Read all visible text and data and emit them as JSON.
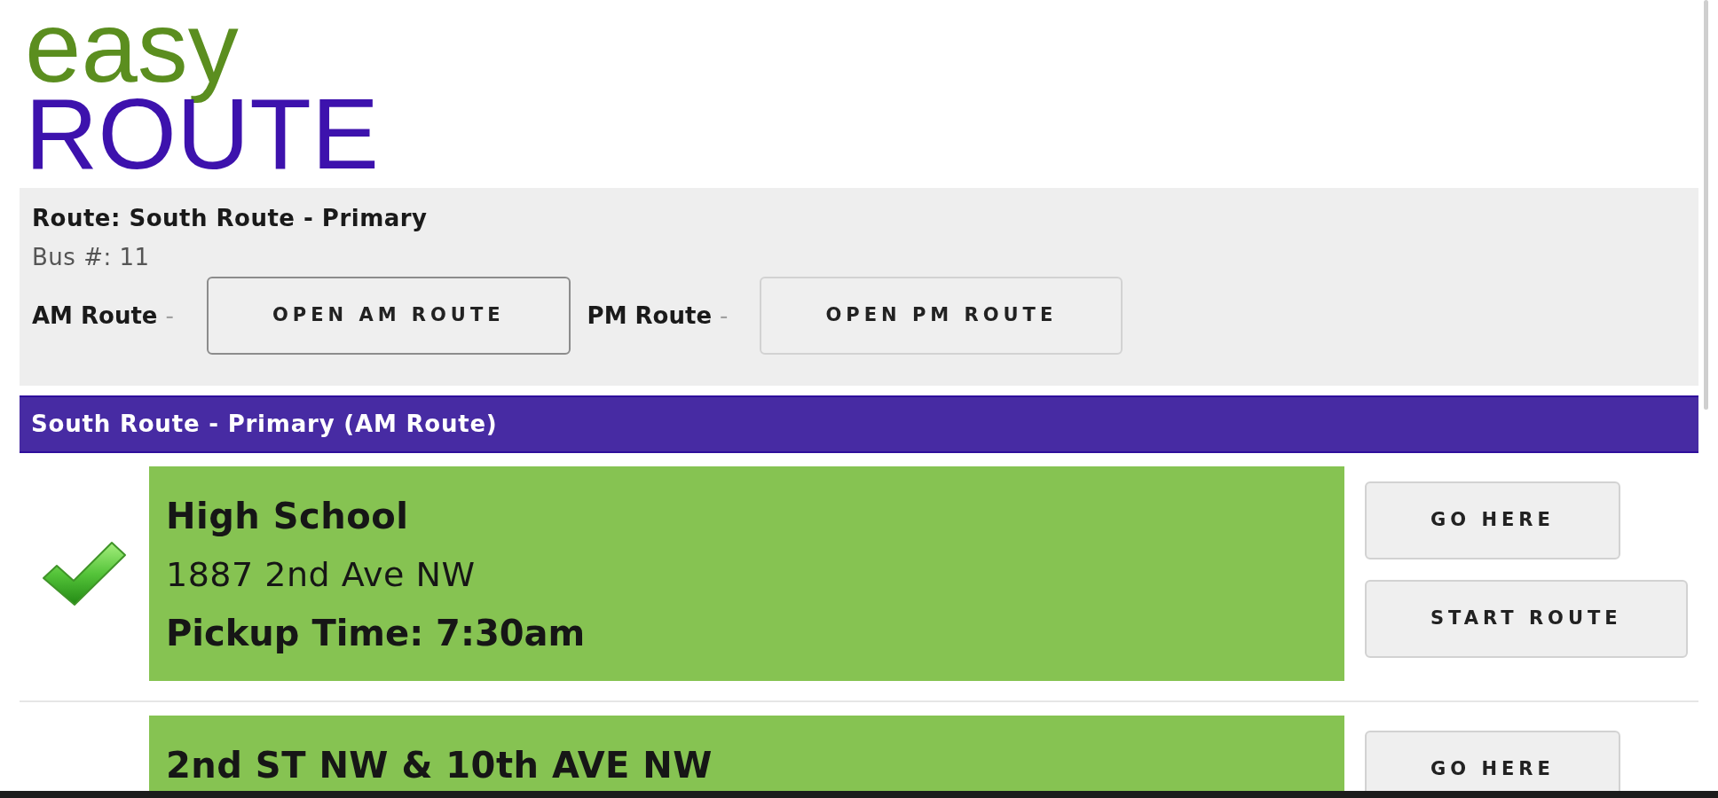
{
  "logo": {
    "line_1": "easy",
    "line_2": "ROUTE"
  },
  "route_panel": {
    "route": "Route: South Route - Primary",
    "bus": "Bus #: 11",
    "route_options": [
      {
        "label": "AM Route",
        "separator": "-",
        "button": "OPEN AM ROUTE",
        "selected": true
      },
      {
        "label": "PM Route",
        "separator": "-",
        "button": "OPEN PM ROUTE",
        "selected": false
      }
    ]
  },
  "route_header": "South Route - Primary (AM Route)",
  "stops": [
    {
      "completed": true,
      "name": "High School",
      "address": "1887 2nd Ave NW",
      "pickup": "Pickup Time: 7:30am",
      "buttons": [
        "GO HERE",
        "START ROUTE"
      ]
    },
    {
      "completed": false,
      "name": "2nd ST NW & 10th AVE NW",
      "buttons": [
        "GO HERE"
      ]
    }
  ]
}
